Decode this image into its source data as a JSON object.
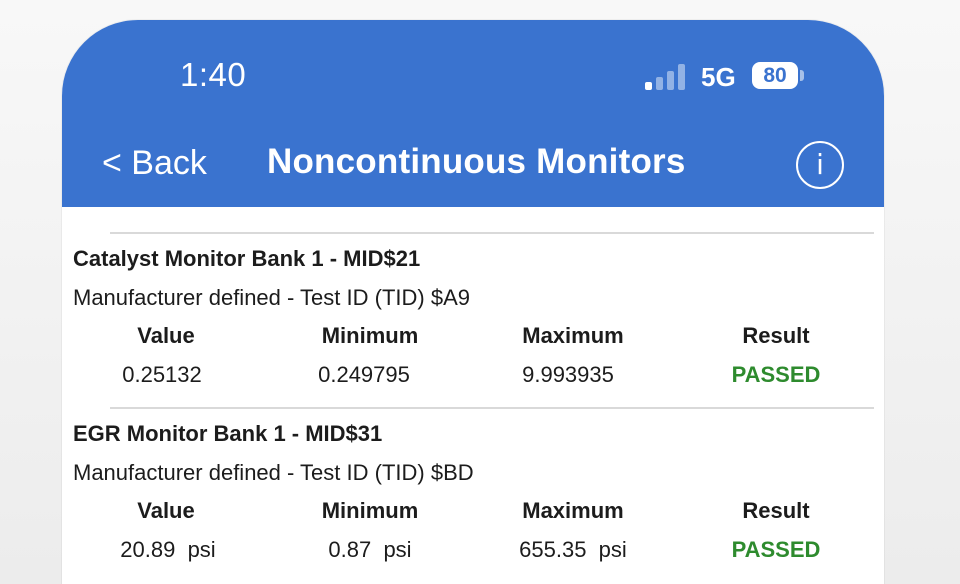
{
  "status_bar": {
    "time": "1:40",
    "network": "5G",
    "battery": "80"
  },
  "nav": {
    "back_label": "< Back",
    "title": "Noncontinuous Monitors",
    "info_label": "i"
  },
  "columns": [
    "Value",
    "Minimum",
    "Maximum",
    "Result"
  ],
  "monitors": [
    {
      "title": "Catalyst Monitor Bank 1 - MID$21",
      "subtitle": "Manufacturer defined - Test ID (TID) $A9",
      "value": "0.25132",
      "minimum": "0.249795",
      "maximum": "9.993935",
      "result": "PASSED"
    },
    {
      "title": "EGR Monitor Bank 1 - MID$31",
      "subtitle": "Manufacturer defined - Test ID (TID) $BD",
      "value": "20.89  psi",
      "minimum": "0.87  psi",
      "maximum": "655.35  psi",
      "result": "PASSED"
    }
  ],
  "colors": {
    "header": "#3a73cf",
    "passed": "#2e8b2e"
  }
}
